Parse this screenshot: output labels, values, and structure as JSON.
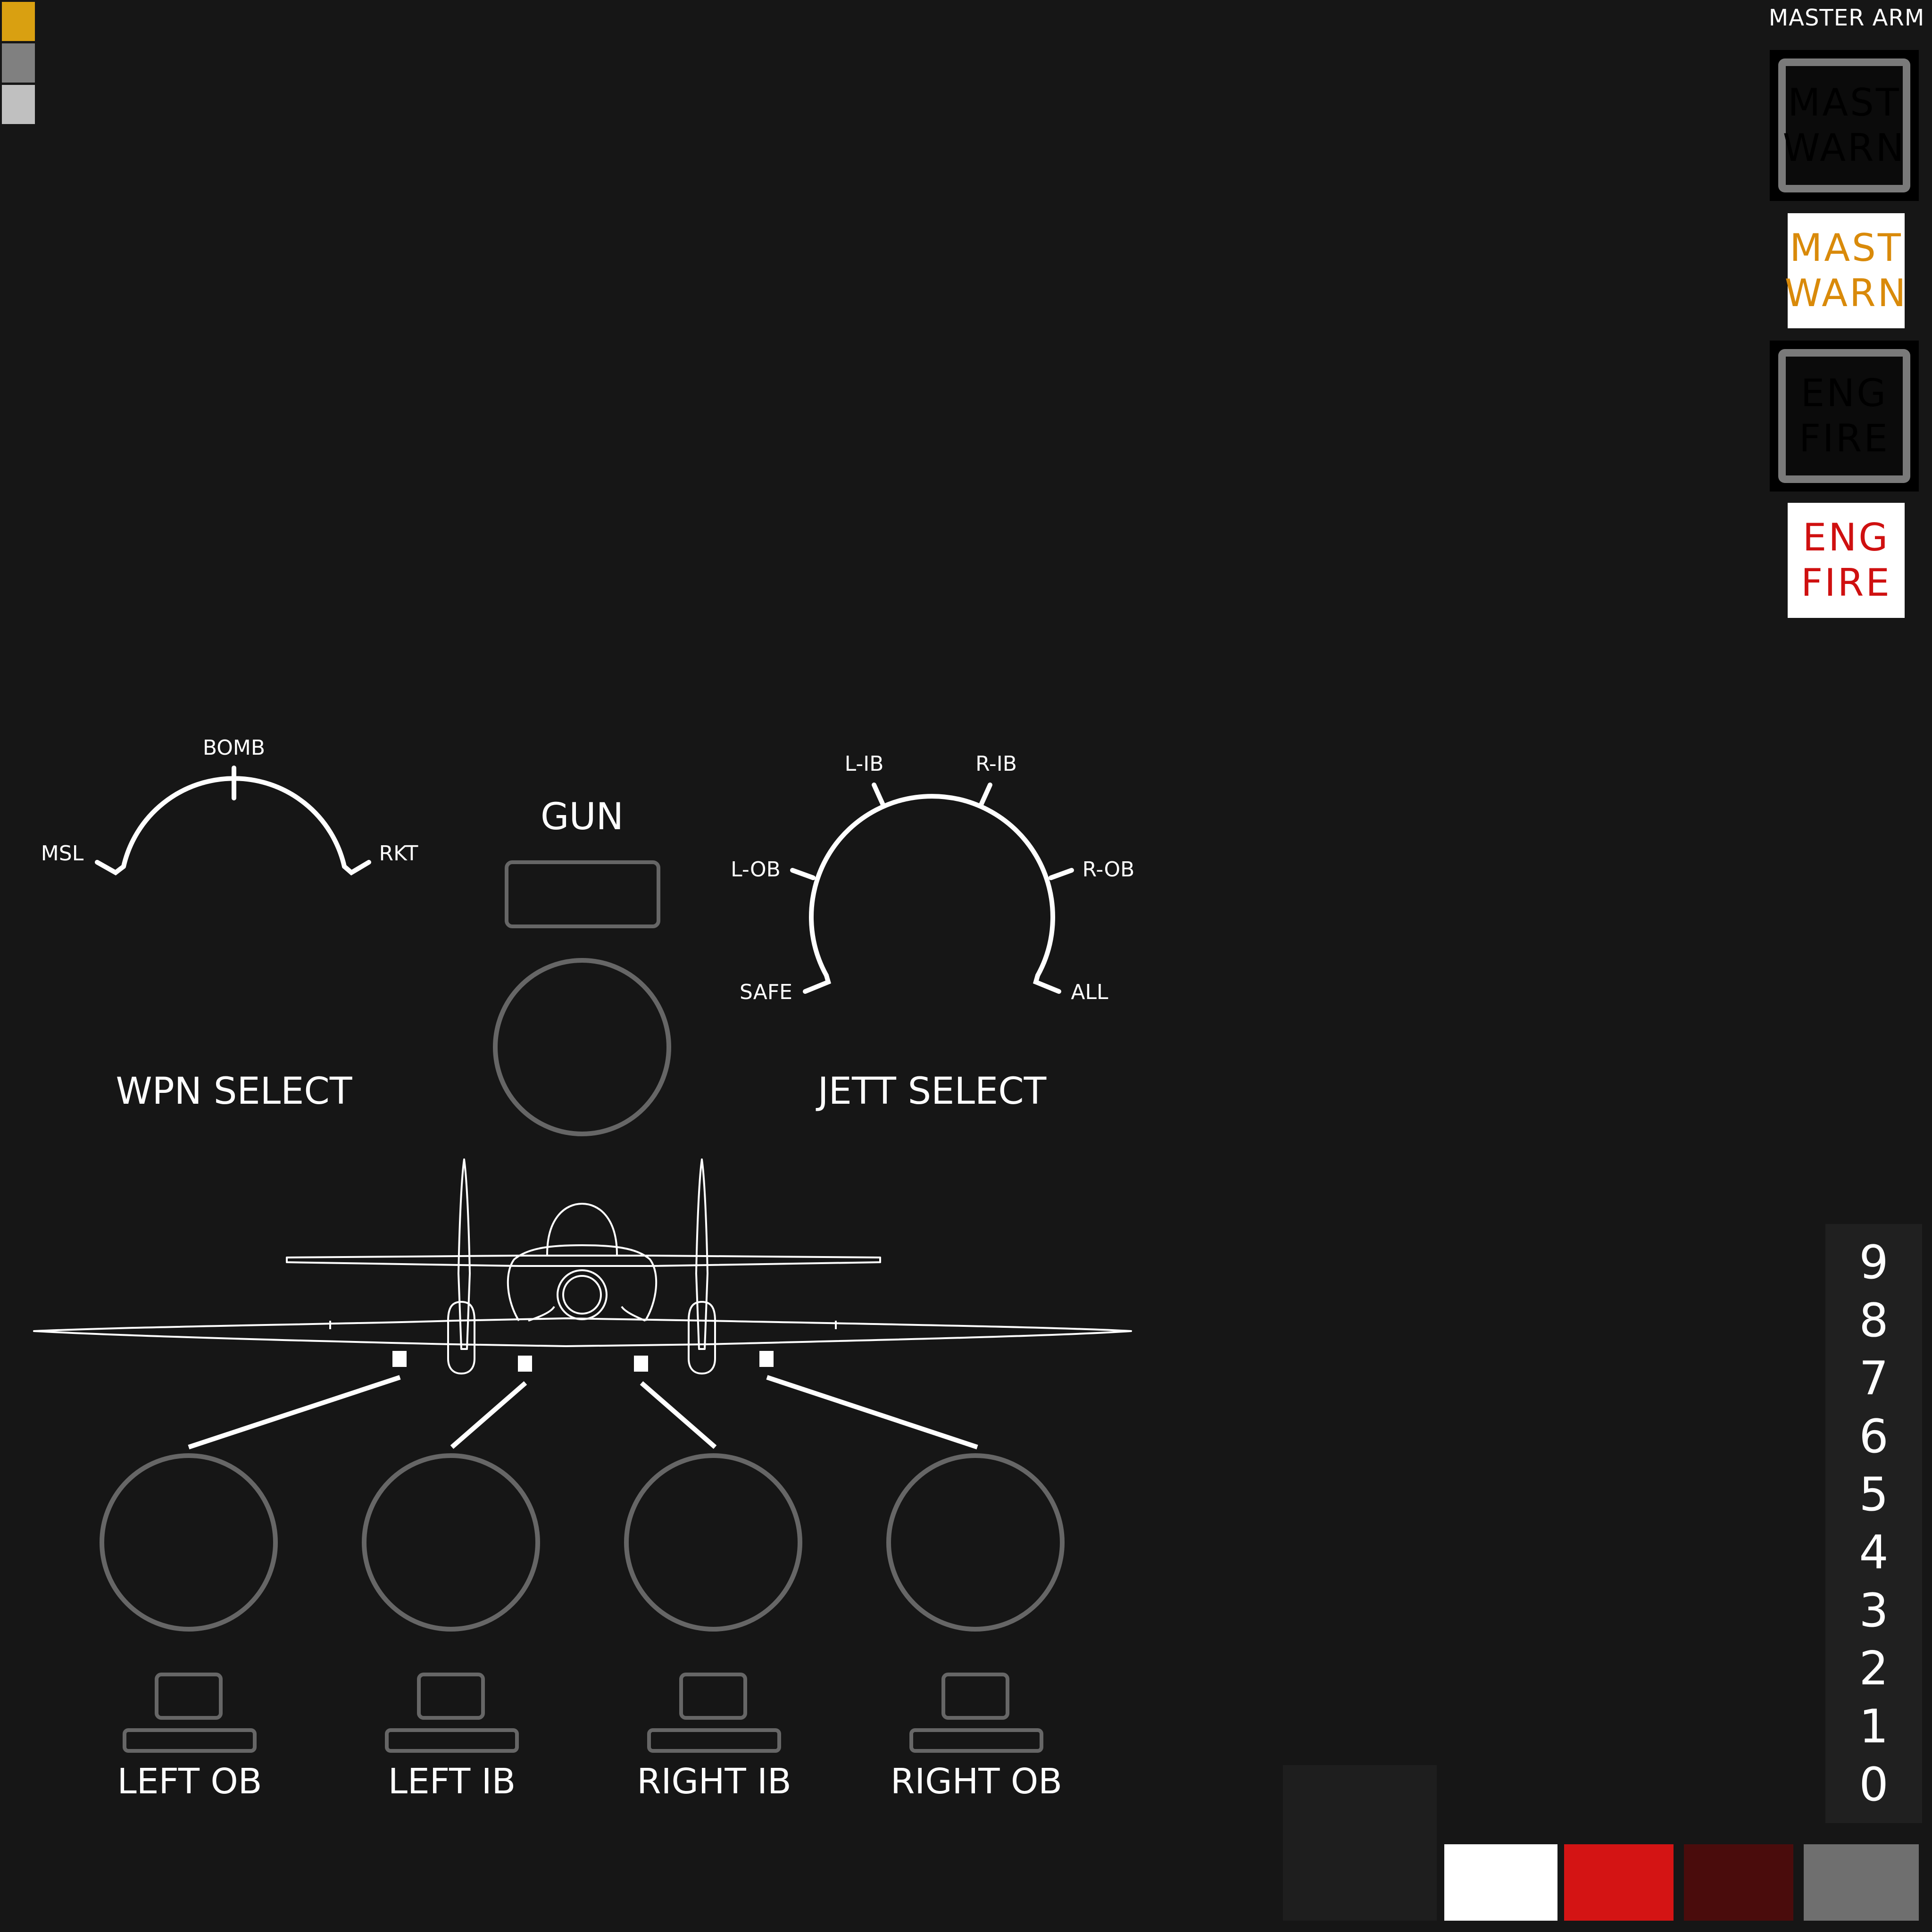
{
  "palette_swatches": [
    "#d9a011",
    "#808080",
    "#c0c0c0"
  ],
  "master_arm": {
    "title": "MASTER ARM"
  },
  "annunciators": [
    {
      "name": "mast-warn",
      "line1": "MAST",
      "line2": "WARN",
      "state": "off",
      "text_color": "#000000"
    },
    {
      "name": "mast-warn",
      "line1": "MAST",
      "line2": "WARN",
      "state": "lit",
      "text_color": "#d98a0a"
    },
    {
      "name": "eng-fire",
      "line1": "ENG",
      "line2": "FIRE",
      "state": "off",
      "text_color": "#000000"
    },
    {
      "name": "eng-fire",
      "line1": "ENG",
      "line2": "FIRE",
      "state": "lit",
      "text_color": "#cf1010"
    }
  ],
  "wpn_select": {
    "title": "WPN SELECT",
    "positions": [
      "MSL",
      "BOMB",
      "RKT"
    ]
  },
  "gun": {
    "title": "GUN"
  },
  "jett_select": {
    "title": "JETT SELECT",
    "positions": [
      "SAFE",
      "L-OB",
      "L-IB",
      "R-IB",
      "R-OB",
      "ALL"
    ]
  },
  "stations": [
    {
      "label": "LEFT OB"
    },
    {
      "label": "LEFT IB"
    },
    {
      "label": "RIGHT IB"
    },
    {
      "label": "RIGHT OB"
    }
  ],
  "digit_scale": [
    "9",
    "8",
    "7",
    "6",
    "5",
    "4",
    "3",
    "2",
    "1",
    "0"
  ],
  "bottom_palette": [
    "#1e1e1e",
    "#ffffff",
    "#d41414",
    "#4a0c0c",
    "#6f6f6f"
  ]
}
